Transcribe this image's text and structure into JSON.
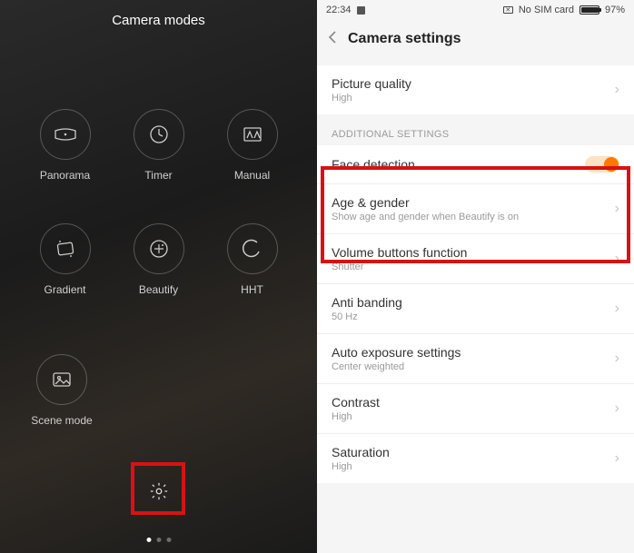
{
  "left": {
    "title": "Camera modes",
    "modes": [
      {
        "key": "panorama",
        "label": "Panorama"
      },
      {
        "key": "timer",
        "label": "Timer"
      },
      {
        "key": "manual",
        "label": "Manual"
      },
      {
        "key": "gradient",
        "label": "Gradient"
      },
      {
        "key": "beautify",
        "label": "Beautify"
      },
      {
        "key": "hht",
        "label": "HHT"
      }
    ],
    "scene": {
      "label": "Scene mode"
    }
  },
  "status": {
    "time": "22:34",
    "sim": "No SIM card",
    "battery_pct": "97%",
    "battery_fill_pct": 97
  },
  "header": {
    "title": "Camera settings"
  },
  "settings": {
    "picture_quality": {
      "title": "Picture quality",
      "sub": "High"
    },
    "section_additional": "ADDITIONAL SETTINGS",
    "face_detection": {
      "title": "Face detection",
      "on": true
    },
    "age_gender": {
      "title": "Age & gender",
      "sub": "Show age and gender when Beautify is on"
    },
    "volume_buttons": {
      "title": "Volume buttons function",
      "sub": "Shutter"
    },
    "anti_banding": {
      "title": "Anti banding",
      "sub": "50 Hz"
    },
    "auto_exposure": {
      "title": "Auto exposure settings",
      "sub": "Center weighted"
    },
    "contrast": {
      "title": "Contrast",
      "sub": "High"
    },
    "saturation": {
      "title": "Saturation",
      "sub": "High"
    }
  }
}
